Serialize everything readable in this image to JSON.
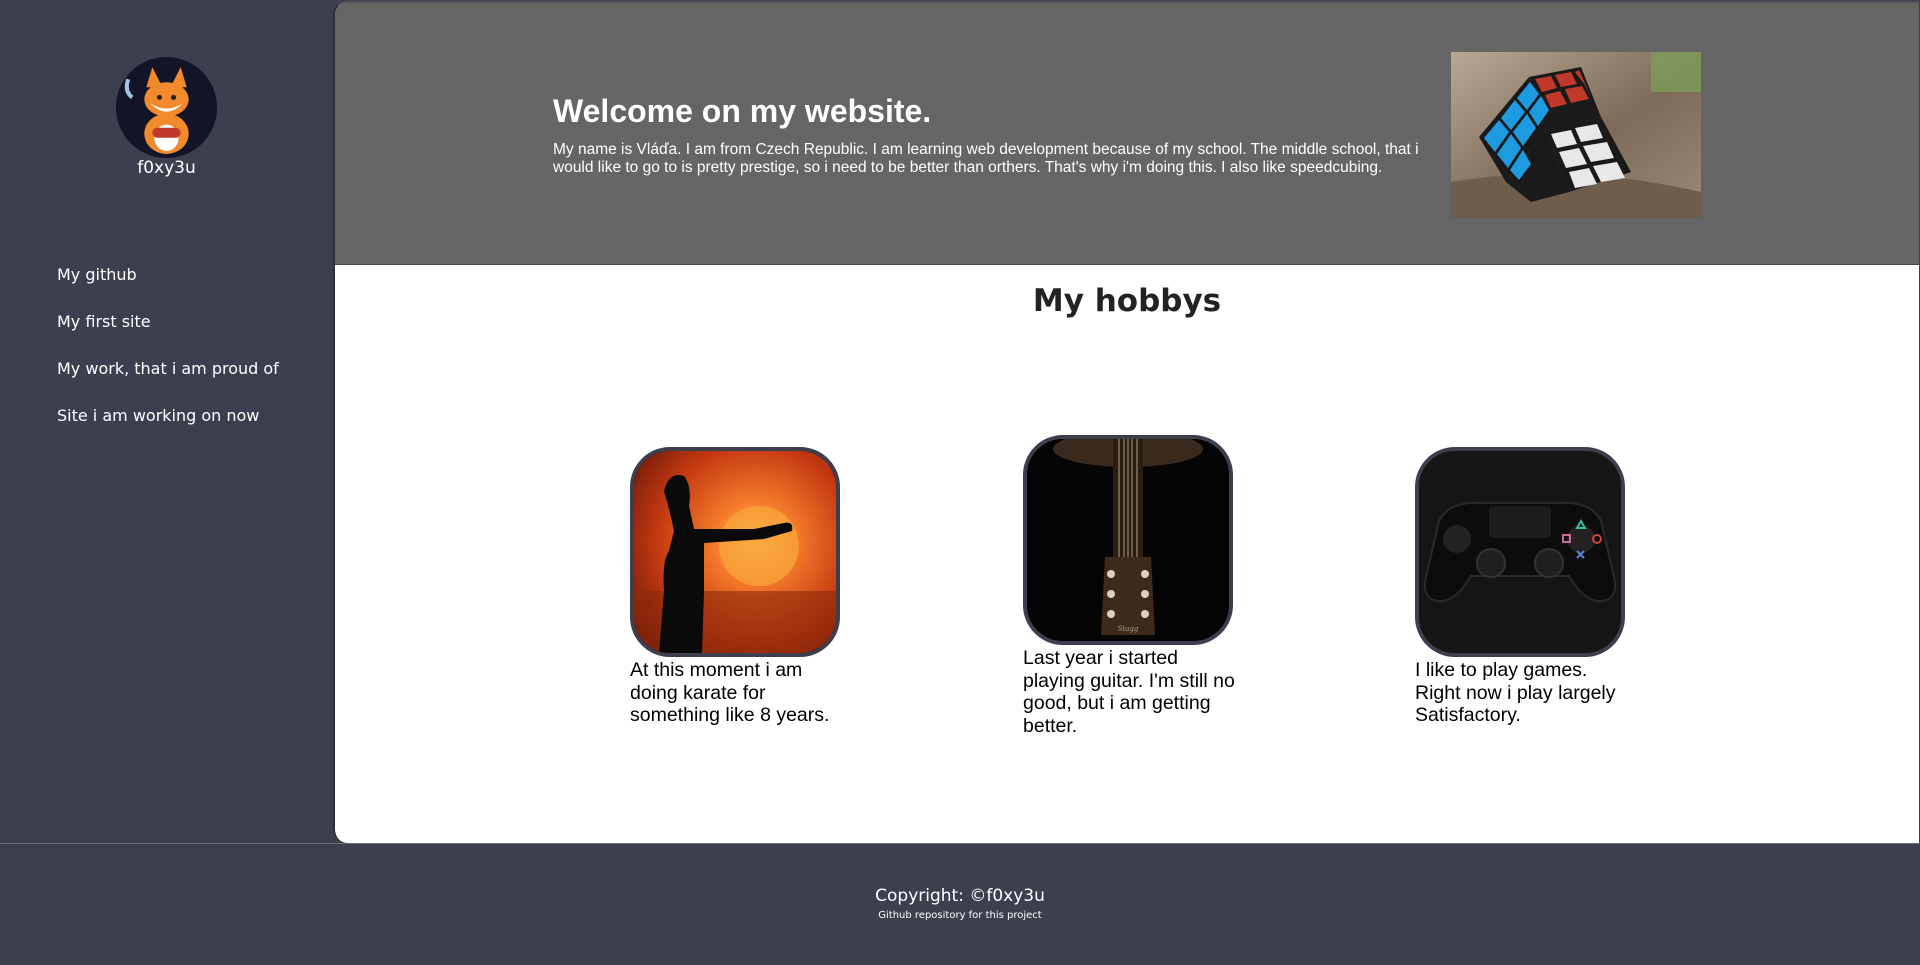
{
  "sidebar": {
    "username": "f0xy3u",
    "nav": [
      {
        "label": "My github"
      },
      {
        "label": "My first site"
      },
      {
        "label": "My work, that i am proud of"
      },
      {
        "label": "Site i am working on now"
      }
    ]
  },
  "header": {
    "title": "Welcome on my website.",
    "text": "My name is Vláďa. I am from Czech Republic. I am learning web development because of my school. The middle school, that i would like to go to is pretty prestige, so i need to be better than orthers. That's why i'm doing this. I also like speedcubing."
  },
  "hobbies": {
    "title": "My hobbys",
    "items": [
      {
        "caption": "At this moment i am doing karate for something like 8 years.",
        "icon": "karate-image"
      },
      {
        "caption": "Last year i started playing guitar. I'm still no good, but i am getting better.",
        "icon": "guitar-image"
      },
      {
        "caption": "I like to play games. Right now i play largely Satisfactory.",
        "icon": "gamepad-image"
      }
    ]
  },
  "footer": {
    "copyright": "Copyright: ©f0xy3u",
    "repo_link": "Github repository for this project"
  },
  "colors": {
    "sidebar_bg": "#3d3f4f",
    "header_bg": "#656565",
    "main_bg": "#ffffff"
  }
}
